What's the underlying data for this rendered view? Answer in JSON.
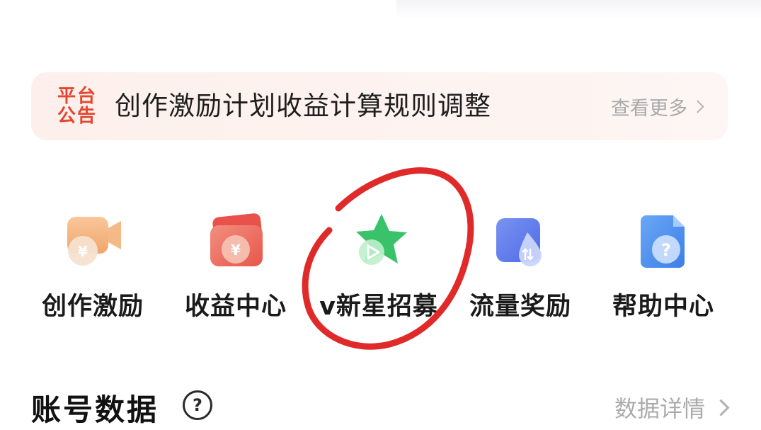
{
  "notice": {
    "tag_line1": "平台",
    "tag_line2": "公告",
    "title": "创作激励计划收益计算规则调整",
    "more": "查看更多"
  },
  "menu": [
    {
      "label": "创作激励",
      "icon": "video-yuan-icon"
    },
    {
      "label": "收益中心",
      "icon": "wallet-yuan-icon"
    },
    {
      "label": "v新星招募",
      "icon": "star-play-icon"
    },
    {
      "label": "流量奖励",
      "icon": "ticket-drop-icon"
    },
    {
      "label": "帮助中心",
      "icon": "document-question-icon"
    }
  ],
  "account": {
    "title": "账号数据",
    "help_glyph": "?",
    "detail": "数据详情"
  },
  "colors": {
    "accent_red": "#e5462f",
    "annotation_red": "#e02a2a"
  }
}
